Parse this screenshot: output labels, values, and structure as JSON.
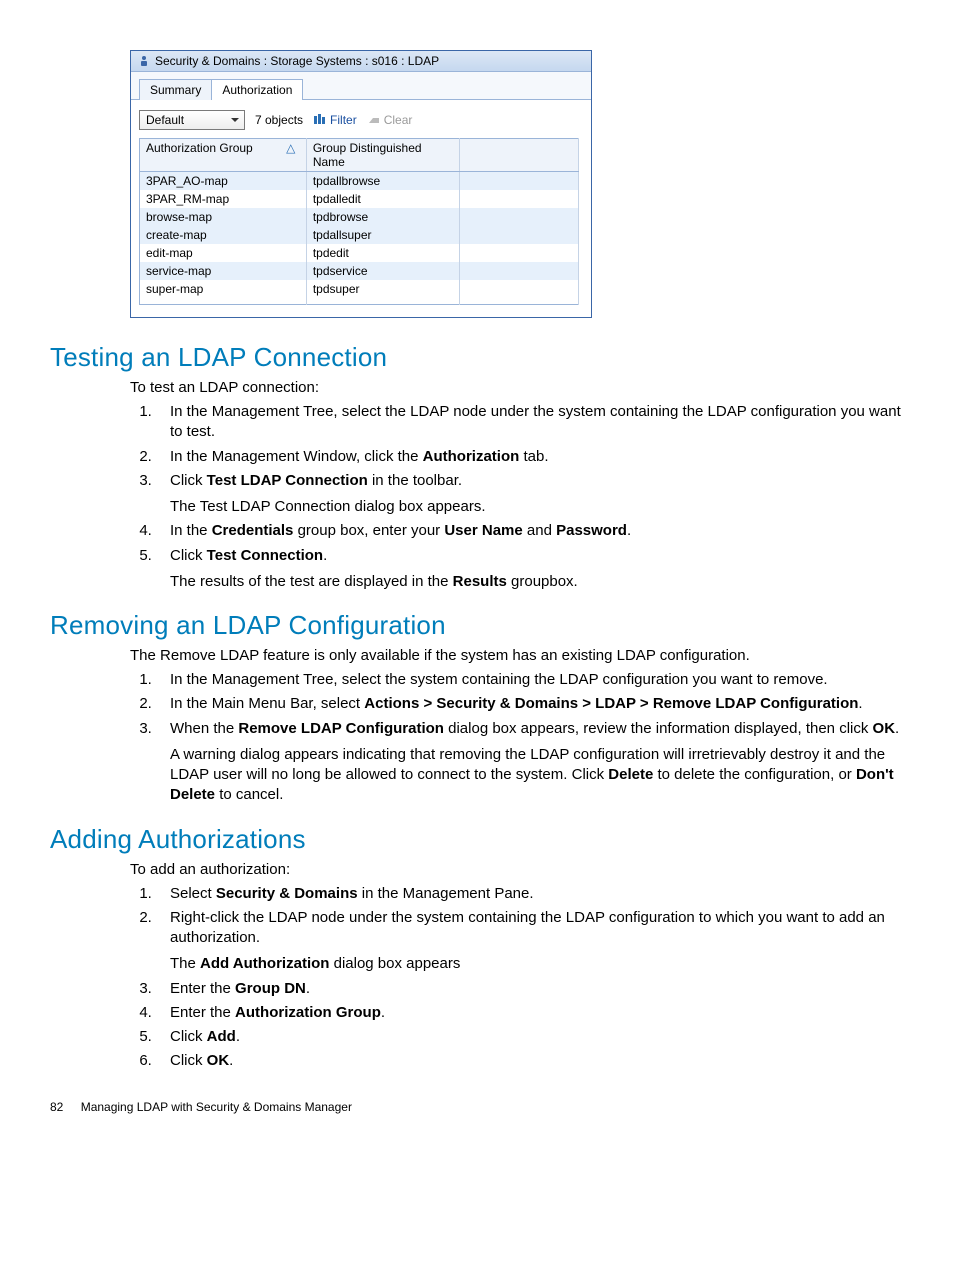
{
  "screenshot": {
    "title": "Security & Domains : Storage Systems : s016 : LDAP",
    "tabs": {
      "summary": "Summary",
      "authorization": "Authorization"
    },
    "toolbar": {
      "combo_value": "Default",
      "objects_label": "7 objects",
      "filter_label": "Filter",
      "clear_label": "Clear"
    },
    "columns": {
      "col1": "Authorization Group",
      "col2": "Group Distinguished Name"
    },
    "rows": [
      {
        "a": "3PAR_AO-map",
        "b": "tpdallbrowse"
      },
      {
        "a": "3PAR_RM-map",
        "b": "tpdalledit"
      },
      {
        "a": "browse-map",
        "b": "tpdbrowse"
      },
      {
        "a": "create-map",
        "b": "tpdallsuper"
      },
      {
        "a": "edit-map",
        "b": "tpdedit"
      },
      {
        "a": "service-map",
        "b": "tpdservice"
      },
      {
        "a": "super-map",
        "b": "tpdsuper"
      }
    ]
  },
  "s1": {
    "heading": "Testing an LDAP Connection",
    "intro": "To test an LDAP connection:",
    "steps": {
      "i1": "In the Management Tree, select the LDAP node under the system containing the LDAP configuration you want to test.",
      "i2a": "In the Management Window, click the ",
      "i2b": "Authorization",
      "i2c": " tab.",
      "i3a": "Click ",
      "i3b": "Test LDAP Connection",
      "i3c": " in the toolbar.",
      "i3sub": "The Test LDAP Connection dialog box appears.",
      "i4a": "In the ",
      "i4b": "Credentials",
      "i4c": " group box, enter your ",
      "i4d": "User Name",
      "i4e": " and ",
      "i4f": "Password",
      "i4g": ".",
      "i5a": "Click ",
      "i5b": "Test Connection",
      "i5c": ".",
      "i5sub_a": "The results of the test are displayed in the ",
      "i5sub_b": "Results",
      "i5sub_c": " groupbox."
    }
  },
  "s2": {
    "heading": "Removing an LDAP Configuration",
    "intro": "The Remove LDAP feature is only available if the system has an existing LDAP configuration.",
    "steps": {
      "i1": "In the Management Tree, select the system containing the LDAP configuration you want to remove.",
      "i2a": "In the Main Menu Bar, select ",
      "i2b": "Actions > Security & Domains > LDAP > Remove LDAP Configuration",
      "i2c": ".",
      "i3a": "When the ",
      "i3b": "Remove LDAP Configuration",
      "i3c": " dialog box appears, review the information displayed, then click ",
      "i3d": "OK",
      "i3e": ".",
      "i3sub_a": "A warning dialog appears indicating that removing the LDAP configuration will irretrievably destroy it and the LDAP user will no long be allowed to connect to the system. Click ",
      "i3sub_b": "Delete",
      "i3sub_c": " to delete the configuration, or ",
      "i3sub_d": "Don't Delete",
      "i3sub_e": " to cancel."
    }
  },
  "s3": {
    "heading": "Adding Authorizations",
    "intro": "To add an authorization:",
    "steps": {
      "i1a": "Select ",
      "i1b": "Security & Domains",
      "i1c": " in the Management Pane.",
      "i2": "Right-click the LDAP node under the system containing the LDAP configuration to which you want to add an authorization.",
      "i2sub_a": "The ",
      "i2sub_b": "Add Authorization",
      "i2sub_c": " dialog box appears",
      "i3a": "Enter the ",
      "i3b": "Group DN",
      "i3c": ".",
      "i4a": "Enter the ",
      "i4b": "Authorization Group",
      "i4c": ".",
      "i5a": "Click ",
      "i5b": "Add",
      "i5c": ".",
      "i6a": "Click ",
      "i6b": "OK",
      "i6c": "."
    }
  },
  "footer": {
    "page": "82",
    "chapter": "Managing LDAP with Security & Domains Manager"
  }
}
